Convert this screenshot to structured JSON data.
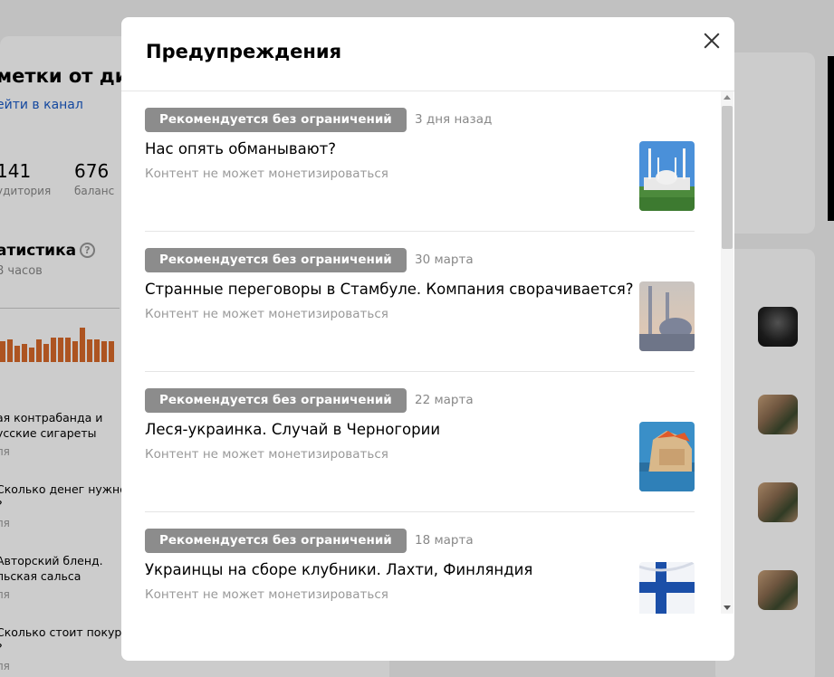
{
  "background": {
    "title": "метки от ди",
    "link": "ейти в канал",
    "stats": [
      {
        "value": "141",
        "caption": "удитория"
      },
      {
        "value": "676",
        "caption": "баланс"
      }
    ],
    "stat_title": "атистика",
    "stat_sub": "8 часов",
    "help_icon_glyph": "?",
    "items": [
      {
        "line1": "ая контрабанда и",
        "line2": "усские сигареты",
        "date": "ля"
      },
      {
        "line1": "Сколько денег нужно",
        "line2": "?",
        "date": "ля"
      },
      {
        "line1": "Авторский бленд.",
        "line2": "льская сальса",
        "date": "ля"
      },
      {
        "line1": "Сколько стоит покури",
        "line2": "?",
        "date": "ля"
      }
    ],
    "bar_levels": [
      0.5,
      0.55,
      0.4,
      0.45,
      0.35,
      0.55,
      0.45,
      0.6,
      0.6,
      0.6,
      0.5,
      0.85,
      0.55,
      0.55,
      0.5,
      0.5
    ]
  },
  "modal": {
    "title": "Предупреждения",
    "close_icon": "close-icon",
    "items": [
      {
        "badge": "Рекомендуется без ограничений",
        "date": "3 дня назад",
        "title": "Нас опять обманывают?",
        "subtitle": "Контент не может монетизироваться",
        "thumb": "mosque-photo"
      },
      {
        "badge": "Рекомендуется без ограничений",
        "date": "30 марта",
        "title": "Странные переговоры в Стамбуле. Компания сворачивается?",
        "subtitle": "Контент не может монетизироваться",
        "thumb": "istanbul-photo"
      },
      {
        "badge": "Рекомендуется без ограничений",
        "date": "22 марта",
        "title": "Леся-украинка. Случай в Черногории",
        "subtitle": "Контент не может монетизироваться",
        "thumb": "montenegro-photo"
      },
      {
        "badge": "Рекомендуется без ограничений",
        "date": "18 марта",
        "title": "Украинцы на сборе клубники. Лахти, Финляндия",
        "subtitle": "Контент не может монетизироваться",
        "thumb": "finland-flag-photo"
      }
    ]
  },
  "colors": {
    "badge": "#8c8c8c",
    "link": "#1a5bc7",
    "bars": "#d9692a"
  }
}
